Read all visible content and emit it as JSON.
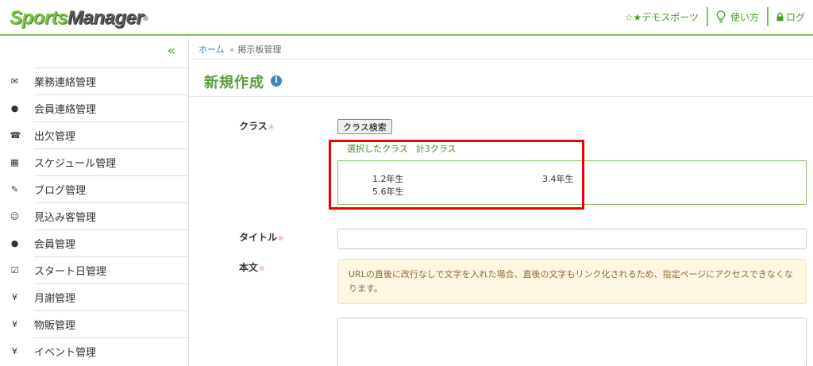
{
  "header": {
    "logo_part1": "Sports",
    "logo_part2": "Manager",
    "logo_reg": "®",
    "nav": {
      "demo": "☆★デモスポーツ",
      "howto": "使い方",
      "logout": "ログ"
    }
  },
  "sidebar": {
    "collapse": "«",
    "items": [
      {
        "icon": "✉",
        "label": "業務連絡管理"
      },
      {
        "icon": "●",
        "label": "会員連絡管理"
      },
      {
        "icon": "☎",
        "label": "出欠管理"
      },
      {
        "icon": "▦",
        "label": "スケジュール管理"
      },
      {
        "icon": "✎",
        "label": "ブログ管理"
      },
      {
        "icon": "☺",
        "label": "見込み客管理"
      },
      {
        "icon": "●",
        "label": "会員管理"
      },
      {
        "icon": "☑",
        "label": "スタート日管理"
      },
      {
        "icon": "¥",
        "label": "月謝管理"
      },
      {
        "icon": "¥",
        "label": "物販管理"
      },
      {
        "icon": "¥",
        "label": "イベント管理"
      }
    ]
  },
  "breadcrumb": {
    "home": "ホーム",
    "sep": "»",
    "current": "掲示板管理"
  },
  "page": {
    "title": "新規作成",
    "info_icon": "i"
  },
  "form": {
    "class_label": "クラス",
    "required_mark": "※",
    "class_search_button": "クラス検索",
    "selected_label": "選択したクラス",
    "selected_count": "計3クラス",
    "selected_classes": [
      "1.2年生",
      "3.4年生",
      "5.6年生"
    ],
    "title_label": "タイトル",
    "title_value": "",
    "body_label": "本文",
    "notice": "URLの直後に改行なしで文字を入れた場合、直後の文字もリンク化されるため、指定ページにアクセスできなくなります。"
  },
  "colors": {
    "accent_green": "#7bbf58",
    "title_green": "#5a9e3a",
    "link_blue": "#3a7ebf",
    "highlight_red": "#e00000"
  }
}
